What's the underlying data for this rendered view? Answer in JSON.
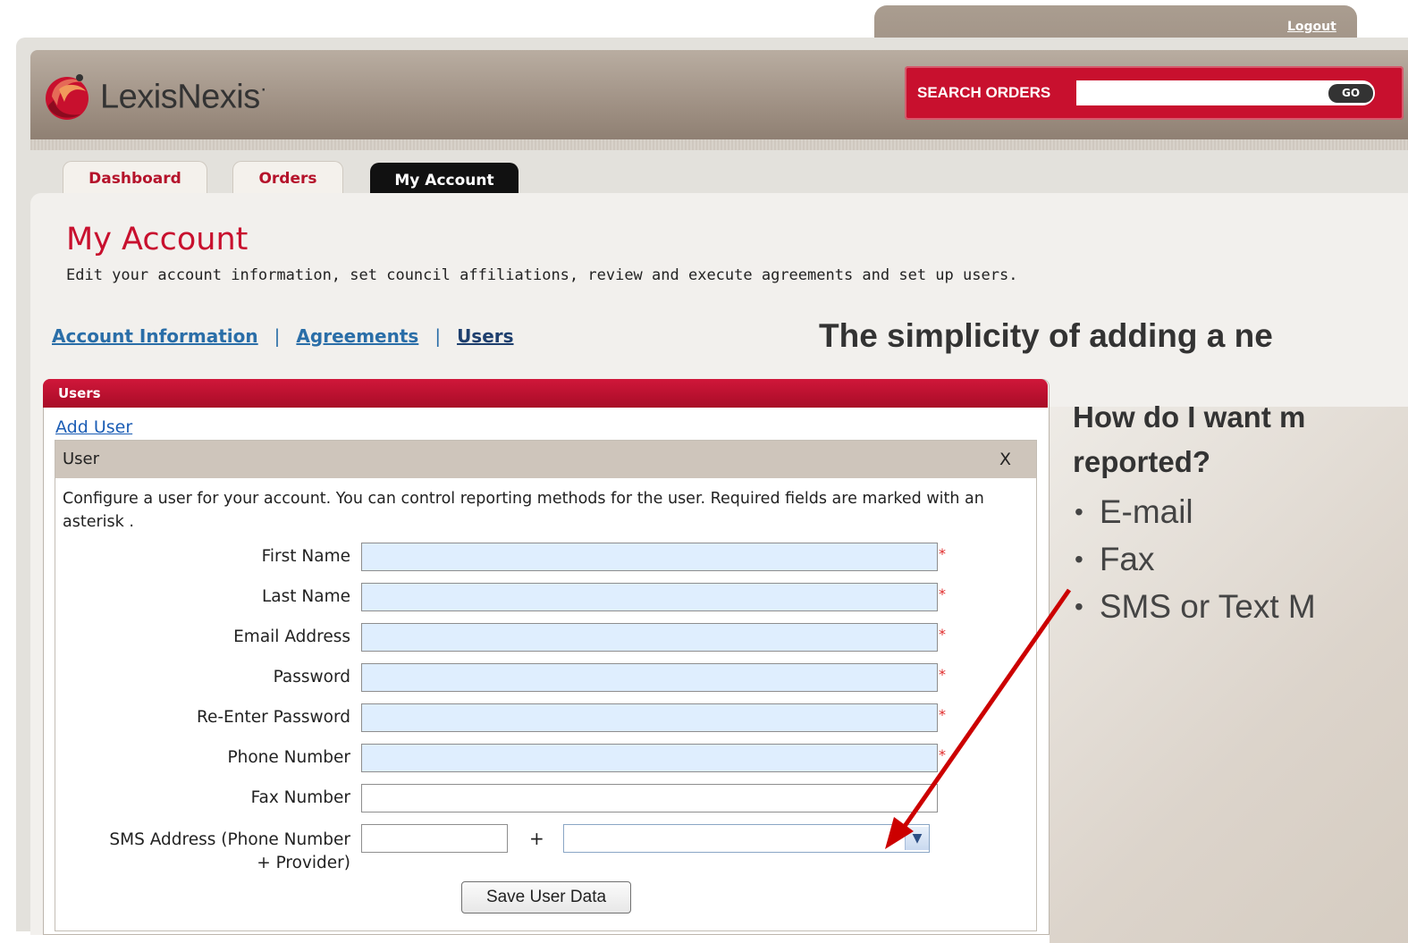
{
  "header": {
    "logout": "Logout",
    "logo_text": "LexisNexis",
    "logo_reg": "·",
    "search_label": "SEARCH ORDERS",
    "search_value": "",
    "go_label": "GO"
  },
  "tabs": [
    {
      "label": "Dashboard",
      "active": false
    },
    {
      "label": "Orders",
      "active": false
    },
    {
      "label": "My Account",
      "active": true
    }
  ],
  "page": {
    "title": "My Account",
    "subtitle": "Edit your account information, set council affiliations, review and execute agreements and set up users."
  },
  "subnav": {
    "items": [
      "Account Information",
      "Agreements",
      "Users"
    ],
    "separator": "|"
  },
  "users": {
    "header": "Users",
    "add_user": "Add User",
    "panel_title": "User",
    "close": "X",
    "intro": "Configure a user for your account. You can control reporting methods for the user. Required fields are marked with an asterisk .",
    "fields": [
      {
        "label": "First Name",
        "value": "",
        "required": true
      },
      {
        "label": "Last Name",
        "value": "",
        "required": true
      },
      {
        "label": "Email Address",
        "value": "",
        "required": true
      },
      {
        "label": "Password",
        "value": "",
        "required": true
      },
      {
        "label": "Re-Enter Password",
        "value": "",
        "required": true
      },
      {
        "label": "Phone Number",
        "value": "",
        "required": true
      },
      {
        "label": "Fax Number",
        "value": "",
        "required": false
      }
    ],
    "sms": {
      "label_line1": "SMS Address (Phone Number",
      "label_line2": "+ Provider)",
      "plus": "+",
      "phone_value": "",
      "provider_value": ""
    },
    "save_label": "Save User Data",
    "required_mark": "*"
  },
  "callout": {
    "title": "The simplicity of adding a ne",
    "question_line1": "How do I want m",
    "question_line2": "reported?",
    "bullet": "•",
    "items": [
      "E-mail",
      "Fax",
      "SMS or Text M"
    ]
  },
  "colors": {
    "brand_red": "#c8102e",
    "link_blue": "#2a6ea8",
    "input_fill": "#dfeefe",
    "arrow_red": "#cc0000"
  }
}
